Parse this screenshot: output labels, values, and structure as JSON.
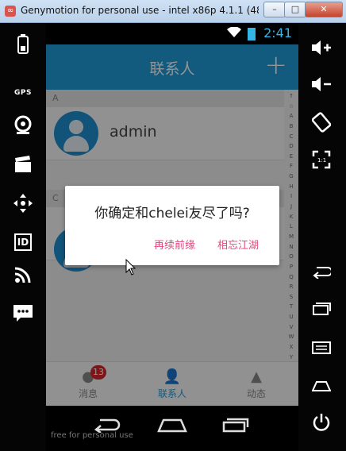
{
  "window": {
    "title": "Genymotion for personal use - intel x86p 4.1.1 (48...",
    "minimize": "–",
    "maximize": "□",
    "close": "✕"
  },
  "left_panel": {
    "items": [
      "battery-icon",
      "gps-icon",
      "camera-icon",
      "media-icon",
      "dpad-icon",
      "id-icon",
      "rss-icon",
      "sms-icon"
    ],
    "gps_label": "GPS",
    "id_label": "ID"
  },
  "right_panel": {
    "items": [
      "volume-up-icon",
      "volume-down-icon",
      "rotate-icon",
      "scale-icon",
      "back-icon",
      "recent-apps-icon",
      "menu-icon",
      "home-icon",
      "power-icon"
    ]
  },
  "status_bar": {
    "time": "2:41"
  },
  "action_bar": {
    "title": "联系人",
    "add": "+"
  },
  "contacts": {
    "section_a": "A",
    "row1_name": "admin",
    "section_c": "C"
  },
  "index_letters": [
    "↑",
    "☆",
    "A",
    "B",
    "C",
    "D",
    "E",
    "F",
    "G",
    "H",
    "I",
    "J",
    "K",
    "L",
    "M",
    "N",
    "O",
    "P",
    "Q",
    "R",
    "S",
    "T",
    "U",
    "V",
    "W",
    "X",
    "Y",
    "Z",
    "#"
  ],
  "tabs": [
    {
      "label": "消息",
      "badge": "13"
    },
    {
      "label": "联系人"
    },
    {
      "label": "动态"
    }
  ],
  "dialog": {
    "message": "你确定和chelei友尽了吗?",
    "cancel": "再续前缘",
    "confirm": "相忘江湖"
  },
  "watermark": "free for personal use",
  "colors": {
    "primary": "#1f9bd9",
    "dialog_button": "#e0477e",
    "badge": "#d9252b"
  }
}
